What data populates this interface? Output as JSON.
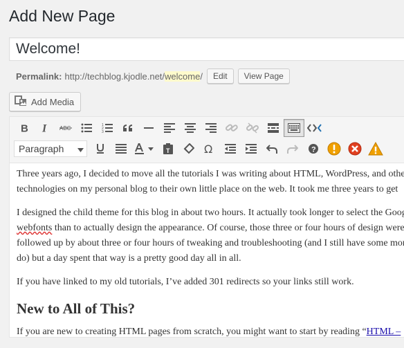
{
  "page": {
    "title": "Add New Page"
  },
  "post": {
    "title": "Welcome!"
  },
  "permalink": {
    "label": "Permalink:",
    "base": "http://techblog.kjodle.net/",
    "slug": "welcome",
    "trailing": "/",
    "edit_label": "Edit",
    "view_label": "View Page"
  },
  "media": {
    "add_label": "Add Media"
  },
  "toolbar": {
    "format_value": "Paragraph",
    "row1": [
      "bold-icon",
      "italic-icon",
      "strikethrough-icon",
      "bullet-list-icon",
      "numbered-list-icon",
      "blockquote-icon",
      "horizontal-rule-icon",
      "align-left-icon",
      "align-center-icon",
      "align-right-icon",
      "insert-link-icon",
      "unlink-icon",
      "read-more-icon",
      "toolbar-toggle-icon",
      "code-icon"
    ],
    "row2": [
      "underline-icon",
      "justify-icon",
      "text-color-icon",
      "paste-as-text-icon",
      "clear-formatting-icon",
      "special-character-icon",
      "outdent-icon",
      "indent-icon",
      "undo-icon",
      "redo-icon",
      "help-icon",
      "warning-orange-icon",
      "error-red-icon",
      "warning-triangle-icon"
    ],
    "colors": {
      "orange": "#f0a000",
      "red": "#e04020",
      "triangle": "#f0a000"
    }
  },
  "content": {
    "p1": "Three years ago, I decided to move all the tutorials I was writing about HTML, WordPress, and other technologies on my personal blog to their own little place on the web. It took me three years to get",
    "p2_part1": "I designed the child theme for this blog in about two hours. It actually took longer to select the Google ",
    "p2_spell": "webfonts",
    "p2_part2": " than to actually design the appearance. Of course, those three or four hours of design were followed up by about three or four hours of tweaking and troubleshooting (and I still have some more to do) but a day spent that way is a pretty good day all in all.",
    "p3": "If you have linked to my old tutorials, I’ve added  301 redirects so your links still work.",
    "heading": "New to All of This?",
    "p4_text": "If you are new to creating HTML pages from scratch, you might want to start by reading “",
    "p4_link": "HTML –"
  }
}
